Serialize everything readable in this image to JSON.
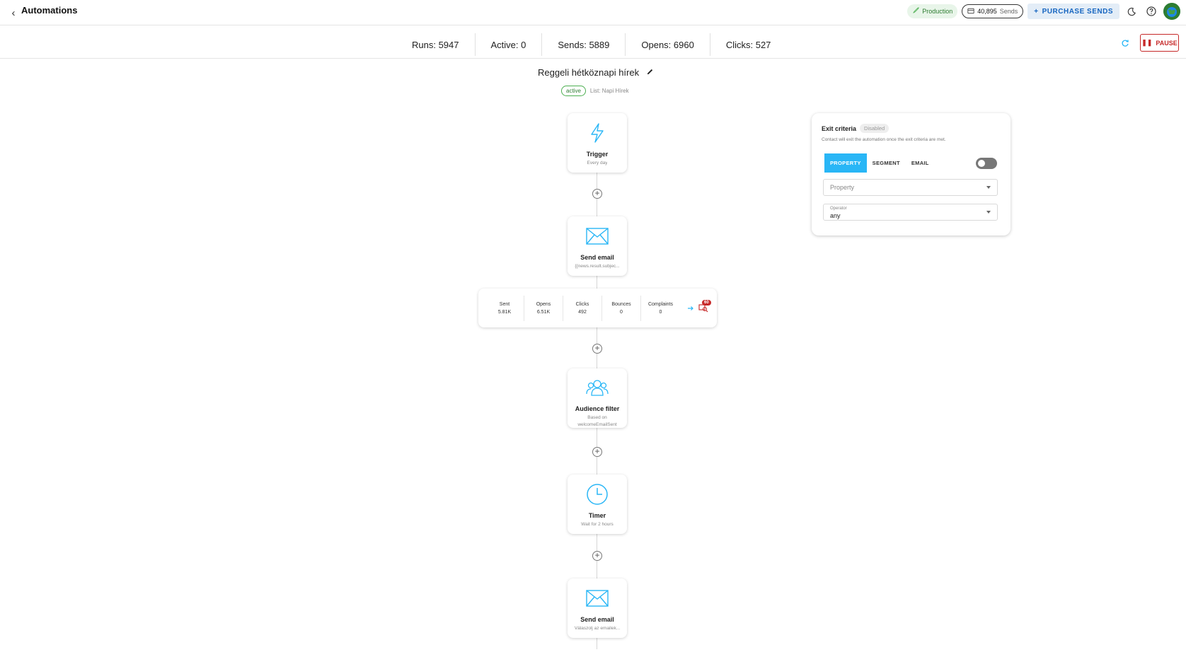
{
  "header": {
    "back_icon": "chevron-left-icon",
    "title": "Automations",
    "environment": "Production",
    "sends_count": "40,895",
    "sends_unit": "Sends",
    "purchase_label": "PURCHASE SENDS",
    "accent_color": "#1565c0"
  },
  "stats": [
    {
      "label": "Runs: 5947"
    },
    {
      "label": "Active: 0"
    },
    {
      "label": "Sends: 5889"
    },
    {
      "label": "Opens: 6960"
    },
    {
      "label": "Clicks: 527"
    }
  ],
  "actions": {
    "pause_label": "PAUSE",
    "pause_color": "#c62828"
  },
  "automation": {
    "name": "Reggeli hétköznapi hírek",
    "status": "active",
    "list": "List: Napi Hírek"
  },
  "nodes": [
    {
      "title": "Trigger",
      "subtitle": "Every day",
      "icon": "lightning-icon"
    },
    {
      "title": "Send email",
      "subtitle": "{{news.result.subjec...",
      "icon": "envelope-icon"
    },
    {
      "title": "Audience filter",
      "subtitle": "Based on welcomeEmailSent",
      "icon": "audience-icon"
    },
    {
      "title": "Timer",
      "subtitle": "Wait for 2 hours",
      "icon": "clock-icon"
    },
    {
      "title": "Send email",
      "subtitle": "Válaszolj az emailek...",
      "icon": "envelope-icon"
    }
  ],
  "email_stats": {
    "cells": [
      {
        "label": "Sent",
        "value": "5.81K"
      },
      {
        "label": "Opens",
        "value": "6.51K"
      },
      {
        "label": "Clicks",
        "value": "492"
      },
      {
        "label": "Bounces",
        "value": "0"
      },
      {
        "label": "Complaints",
        "value": "0"
      }
    ],
    "badge_count": "60"
  },
  "exit_criteria": {
    "title": "Exit criteria",
    "state": "Disabled",
    "description": "Contact will exit the automation once the exit criteria are met.",
    "tabs": [
      "PROPERTY",
      "SEGMENT",
      "EMAIL"
    ],
    "active_tab": "PROPERTY",
    "property_placeholder": "Property",
    "operator_label": "Operator",
    "operator_value": "any",
    "tab_active_color": "#29b6f6"
  }
}
